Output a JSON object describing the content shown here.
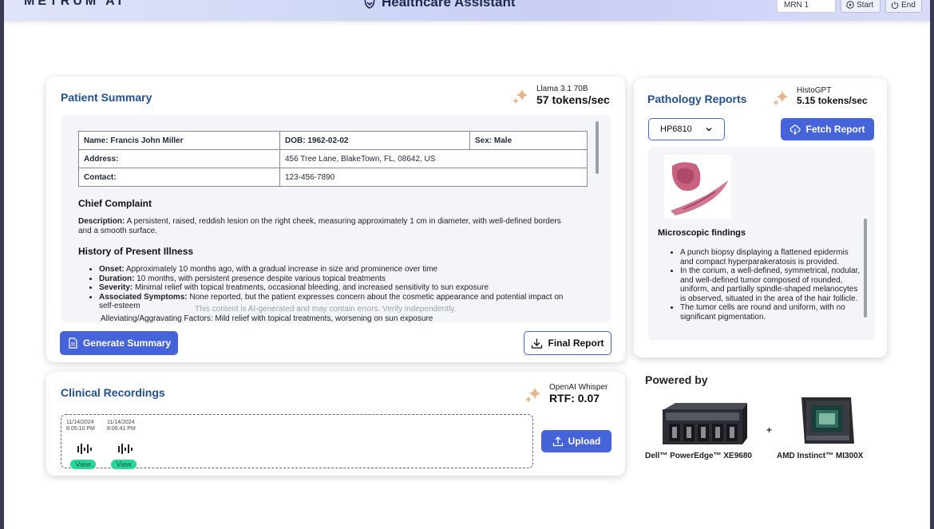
{
  "header": {
    "brand": "METRUM AI",
    "title": "Healthcare Assistant",
    "mrn_value": "MRN 1",
    "start_label": "Start",
    "end_label": "End"
  },
  "patient_summary": {
    "title": "Patient Summary",
    "model_name": "Llama 3.1 70B",
    "model_speed": "57 tokens/sec",
    "table": {
      "name": "Name: Francis John Miller",
      "dob": "DOB: 1962-02-02",
      "sex": "Sex: Male",
      "address_label": "Address:",
      "address_value": "456 Tree Lane, BlakeTown, FL, 08642, US",
      "contact_label": "Contact:",
      "contact_value": "123-456-7890"
    },
    "chief_complaint_heading": "Chief Complaint",
    "description_label": "Description:",
    "description_text": " A persistent, raised, reddish lesion on the right cheek, measuring approximately 1 cm in diameter, with well-defined borders and a smooth surface.",
    "hpi_heading": "History of Present Illness",
    "hpi": [
      {
        "label": "Onset:",
        "text": " Approximately 10 months ago, with a gradual increase in size and prominence over time"
      },
      {
        "label": "Duration:",
        "text": " 10 months, with persistent presence despite various topical treatments"
      },
      {
        "label": "Severity:",
        "text": " Minimal relief with topical treatments, occasional bleeding, and increased sensitivity to sun exposure"
      },
      {
        "label": "Associated Symptoms:",
        "text": " None reported, but the patient expresses concern about the cosmetic appearance and potential impact on self-esteem"
      }
    ],
    "cut_off_line": "Alleviating/Aggravating Factors: Mild relief with topical treatments, worsening on sun exposure",
    "ai_disclaimer": "This content is AI-generated and may contain errors. Verify independently.",
    "generate_label": "Generate Summary",
    "final_report_label": "Final Report"
  },
  "pathology": {
    "title": "Pathology Reports",
    "model_name": "HistoGPT",
    "model_speed": "5.15 tokens/sec",
    "selected_report": "HP6810",
    "fetch_label": "Fetch Report",
    "findings_heading": "Microscopic findings",
    "findings": [
      "A punch biopsy displaying a flattened epidermis and compact hyperparakeratosis is provided.",
      "In the corium, a well-defined, symmetrical, nodular, and well-defined tumor composed of rounded, uniform, and partially spindle-shaped melanocytes is observed, situated in the area of the hair follicle.",
      "The tumor cells are round and uniform, with no significant pigmentation."
    ]
  },
  "recordings": {
    "title": "Clinical Recordings",
    "model_name": "OpenAI Whisper",
    "model_speed": "RTF: 0.07",
    "items": [
      {
        "date": "11/14/2024",
        "time": "8:05:10 PM",
        "view_label": "View"
      },
      {
        "date": "11/14/2024",
        "time": "8:06:41 PM",
        "view_label": "View"
      }
    ],
    "upload_label": "Upload"
  },
  "powered_by": {
    "heading": "Powered by",
    "server": "Dell™ PowerEdge™ XE9680",
    "plus": "+",
    "gpu": "AMD Instinct™ MI300X"
  },
  "colors": {
    "accent": "#4664d9",
    "title_blue": "#23508f",
    "view_green": "#2ad59a",
    "sparkle": "#e8b48a"
  }
}
